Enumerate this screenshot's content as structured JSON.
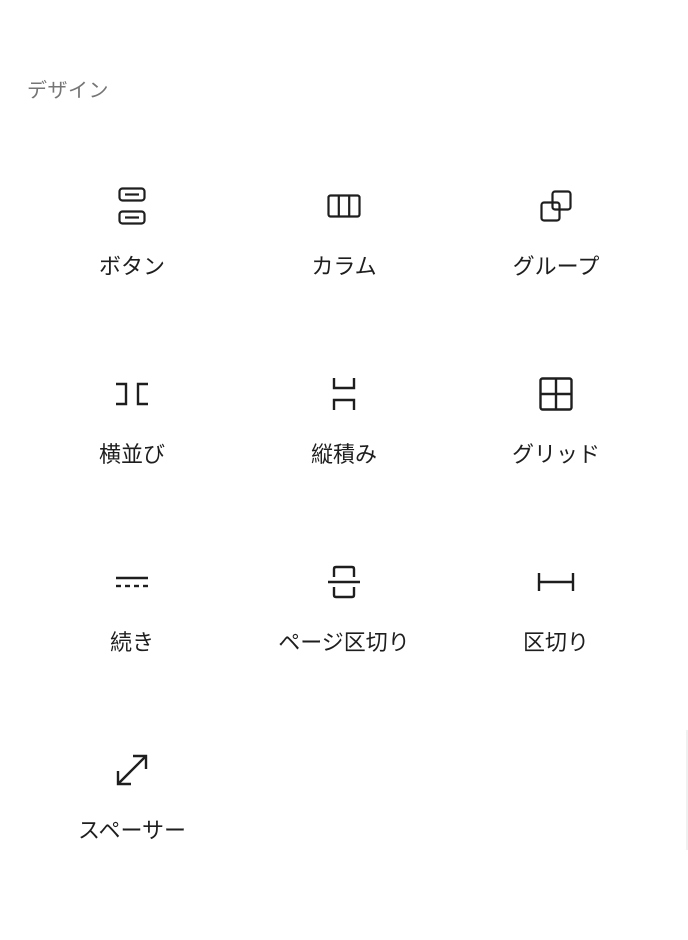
{
  "section": {
    "heading": "デザイン"
  },
  "blocks": [
    {
      "label": "ボタン",
      "icon": "buttons-icon"
    },
    {
      "label": "カラム",
      "icon": "columns-icon"
    },
    {
      "label": "グループ",
      "icon": "group-icon"
    },
    {
      "label": "横並び",
      "icon": "row-icon"
    },
    {
      "label": "縦積み",
      "icon": "stack-icon"
    },
    {
      "label": "グリッド",
      "icon": "grid-icon"
    },
    {
      "label": "続き",
      "icon": "more-icon"
    },
    {
      "label": "ページ区切り",
      "icon": "page-break-icon"
    },
    {
      "label": "区切り",
      "icon": "separator-icon"
    },
    {
      "label": "スペーサー",
      "icon": "spacer-icon"
    }
  ],
  "colors": {
    "text": "#1e1e1e",
    "heading": "#757575",
    "background": "#ffffff"
  }
}
